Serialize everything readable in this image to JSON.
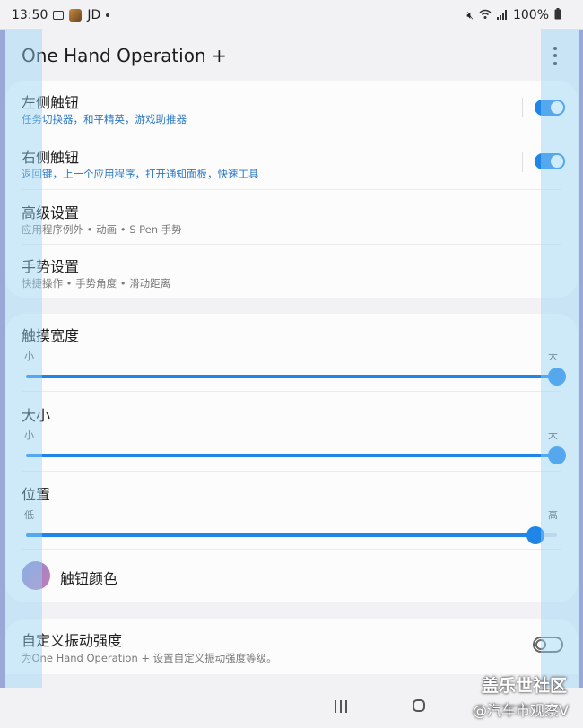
{
  "status_bar": {
    "time": "13:50",
    "carrier": "JD",
    "battery": "100%",
    "icons": [
      "image-icon",
      "avatar-icon",
      "mute-icon",
      "wifi-icon",
      "signal-icon",
      "battery-icon"
    ]
  },
  "app": {
    "title": "One Hand Operation +"
  },
  "handles": {
    "left": {
      "title": "左侧触钮",
      "subtitle": "任务切换器，和平精英，游戏助推器",
      "enabled": true
    },
    "right": {
      "title": "右侧触钮",
      "subtitle": "返回键，上一个应用程序，打开通知面板，快速工具",
      "enabled": true
    }
  },
  "advanced": {
    "title": "高级设置",
    "subtitle": "应用程序例外 • 动画 • S Pen 手势"
  },
  "gesture": {
    "title": "手势设置",
    "subtitle": "快捷操作 • 手势角度 • 滑动距离"
  },
  "sliders": {
    "width": {
      "title": "触摸宽度",
      "min_label": "小",
      "max_label": "大",
      "value": 1.0
    },
    "size": {
      "title": "大小",
      "min_label": "小",
      "max_label": "大",
      "value": 1.0
    },
    "position": {
      "title": "位置",
      "min_label": "低",
      "max_label": "高",
      "value": 0.96
    }
  },
  "handle_color": {
    "title": "触钮颜色"
  },
  "vibration": {
    "title": "自定义振动强度",
    "subtitle": "为One Hand Operation + 设置自定义振动强度等级。",
    "enabled": false
  },
  "watermark": {
    "line1": "盖乐世社区",
    "line2": "@汽车市观察V"
  },
  "colors": {
    "accent": "#1f86e8",
    "edge_bar": "#9d86c0",
    "overlay": "#96d2f5"
  }
}
